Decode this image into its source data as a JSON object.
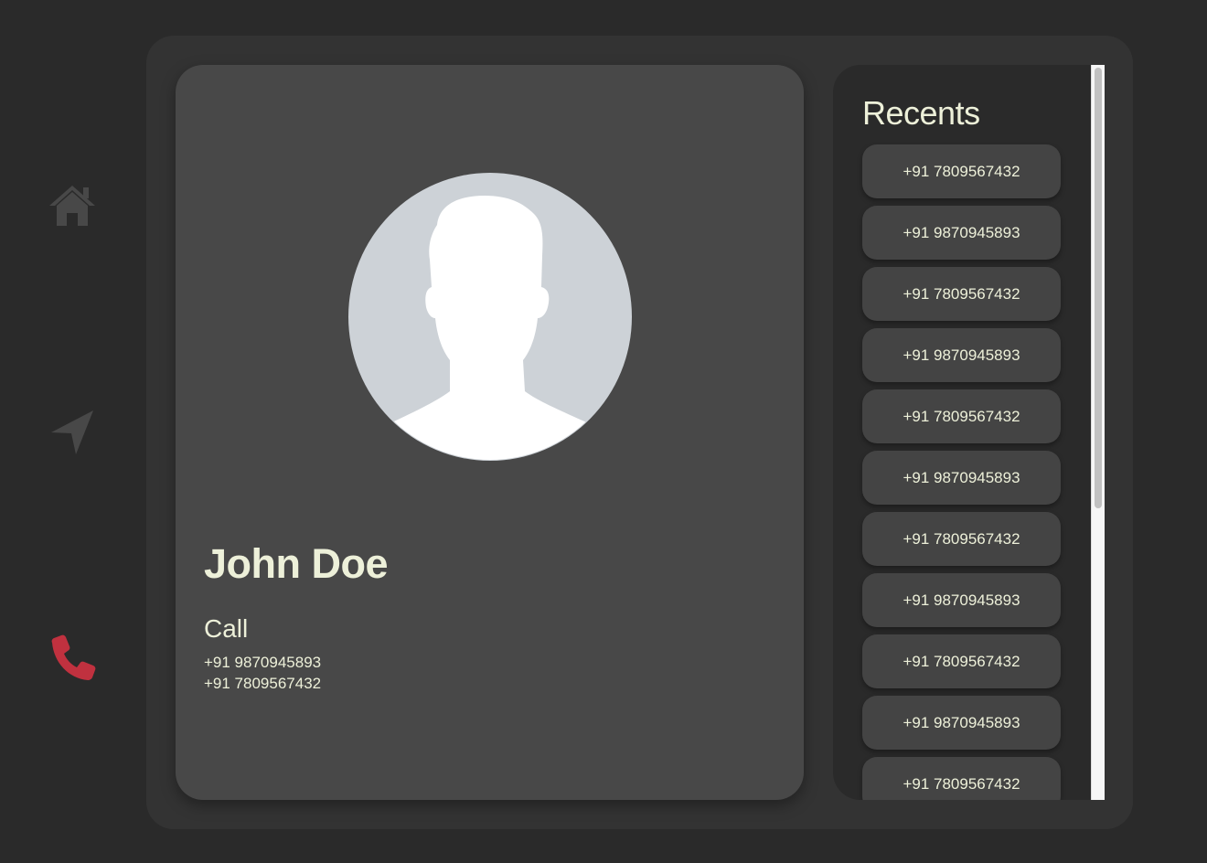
{
  "sidebar": {
    "items": [
      {
        "icon": "home-icon",
        "color": "#484848",
        "active": false
      },
      {
        "icon": "navigation-arrow-icon",
        "color": "#484848",
        "active": false
      },
      {
        "icon": "phone-icon",
        "color": "#c0313f",
        "active": true
      }
    ]
  },
  "contact": {
    "name": "John Doe",
    "call_heading": "Call",
    "numbers": [
      "+91 9870945893",
      "+91 7809567432"
    ]
  },
  "recents": {
    "title": "Recents",
    "items": [
      "+91 7809567432",
      "+91 9870945893",
      "+91 7809567432",
      "+91 9870945893",
      "+91 7809567432",
      "+91 9870945893",
      "+91 7809567432",
      "+91 9870945893",
      "+91 7809567432",
      "+91 9870945893",
      "+91 7809567432"
    ]
  },
  "colors": {
    "background": "#2a2a2a",
    "panel": "#333333",
    "card": "#484848",
    "text": "#edf0d9",
    "accent": "#c0313f"
  }
}
